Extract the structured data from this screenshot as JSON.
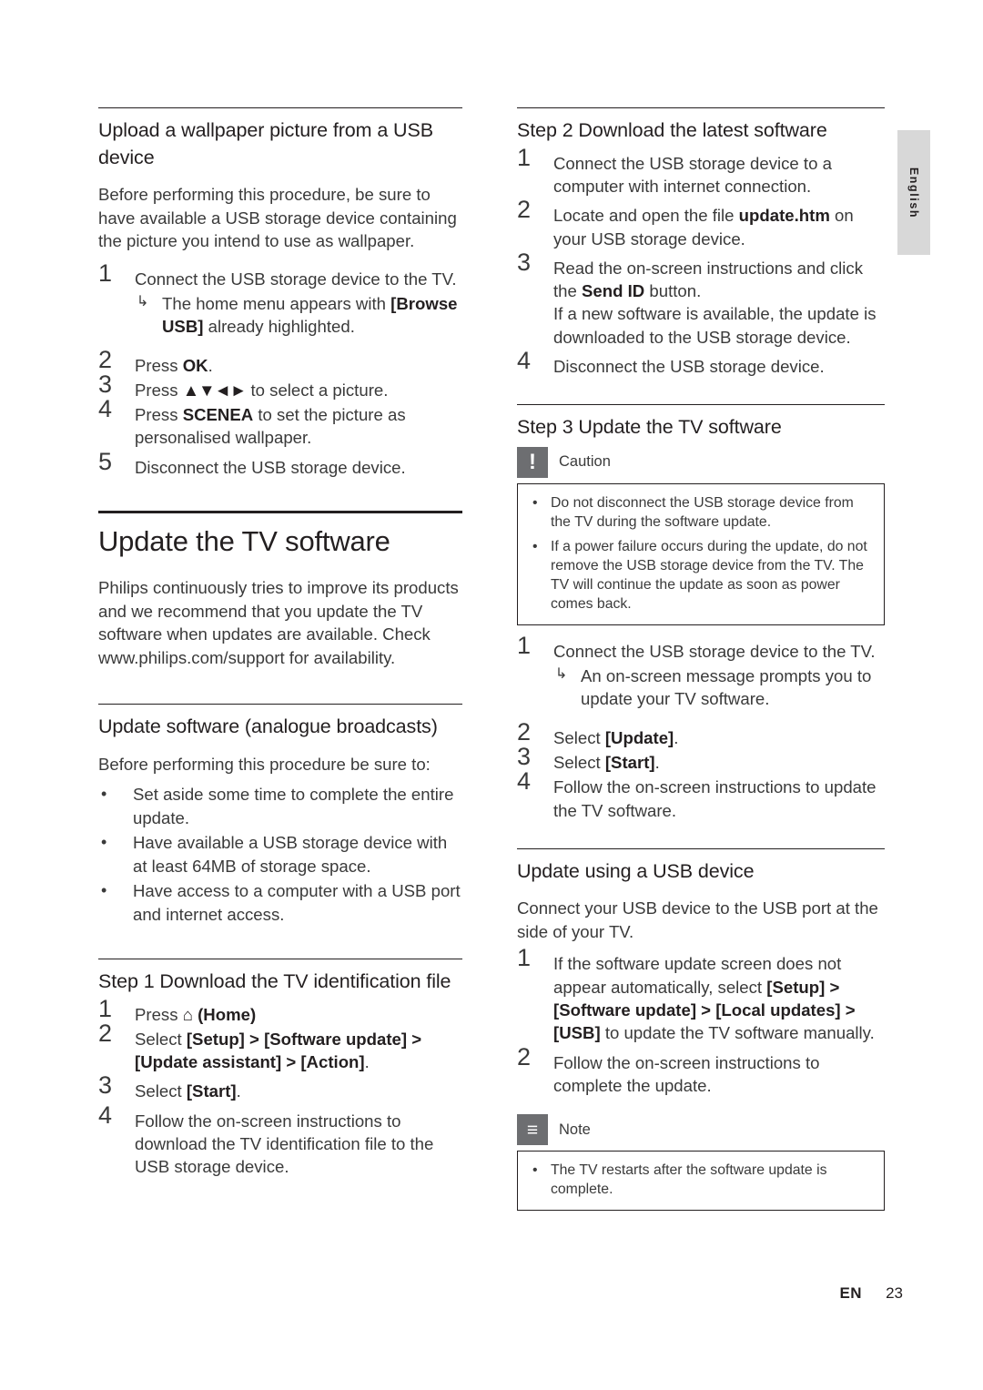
{
  "side_tab": {
    "label": "English"
  },
  "left_column": {
    "section1": {
      "heading": "Upload a wallpaper picture from a USB device",
      "intro": "Before performing this procedure, be sure to have available a USB storage device containing the picture you intend to use as wallpaper.",
      "steps": [
        {
          "num": "1",
          "text": "Connect the USB storage device to the TV.",
          "subnote": "The home menu appears with [Browse USB] already highlighted.",
          "subnote_pre": "The home menu appears with ",
          "subnote_bold": "[Browse USB]",
          "subnote_post": " already highlighted."
        },
        {
          "num": "2",
          "pre": "Press ",
          "bold": "OK",
          "post": "."
        },
        {
          "num": "3",
          "pre": "Press ",
          "bold": "▲▼◄►",
          "post": " to select a picture."
        },
        {
          "num": "4",
          "pre": "Press ",
          "bold": "SCENEA",
          "post": " to set the picture as personalised wallpaper."
        },
        {
          "num": "5",
          "pre": "Disconnect the USB storage device.",
          "bold": "",
          "post": ""
        }
      ]
    },
    "section2": {
      "title": "Update the TV software",
      "intro": "Philips continuously tries to improve its products and we recommend that you update the TV software when updates are available. Check www.philips.com/support for availability."
    },
    "section3": {
      "heading": "Update software (analogue broadcasts)",
      "intro": "Before performing this procedure be sure to:",
      "bullets": [
        "Set aside some time to complete the entire update.",
        "Have available a USB storage device with at least 64MB of storage space.",
        "Have access to a computer with a USB port and internet access."
      ]
    },
    "section4": {
      "heading": "Step 1 Download the TV identification file",
      "steps": [
        {
          "num": "1",
          "pre": "Press ",
          "bold": "⌂ (Home)",
          "post": ""
        },
        {
          "num": "2",
          "pre": "Select ",
          "bold": "[Setup] > [Software update] > [Update assistant] > [Action]",
          "post": "."
        },
        {
          "num": "3",
          "pre": "Select ",
          "bold": "[Start]",
          "post": "."
        },
        {
          "num": "4",
          "pre": "Follow the on-screen instructions to download the TV identification file to the USB storage device.",
          "bold": "",
          "post": ""
        }
      ]
    }
  },
  "right_column": {
    "section1": {
      "heading": "Step 2 Download the latest software",
      "steps": [
        {
          "num": "1",
          "pre": "Connect the USB storage device to a computer with internet connection.",
          "bold": "",
          "post": ""
        },
        {
          "num": "2",
          "pre": "Locate and open the file ",
          "bold": "update.htm",
          "post": " on your USB storage device."
        },
        {
          "num": "3",
          "pre": "Read the on-screen instructions and click the ",
          "bold": "Send ID",
          "post": " button.",
          "extra": "If a new software is available, the update is downloaded to the USB storage device."
        },
        {
          "num": "4",
          "pre": "Disconnect the USB storage device.",
          "bold": "",
          "post": ""
        }
      ]
    },
    "section2": {
      "heading": "Step 3 Update the TV software",
      "caution": {
        "icon": "!",
        "title": "Caution",
        "items": [
          "Do not disconnect the USB storage device from the TV during the software update.",
          "If a power failure occurs during the update, do not remove the USB storage device from the TV. The TV will continue the update as soon as power comes back."
        ]
      },
      "steps": [
        {
          "num": "1",
          "pre": "Connect the USB storage device to the TV.",
          "bold": "",
          "post": "",
          "subnote": "An on-screen message prompts you to update your TV software."
        },
        {
          "num": "2",
          "pre": "Select ",
          "bold": "[Update]",
          "post": "."
        },
        {
          "num": "3",
          "pre": "Select ",
          "bold": "[Start]",
          "post": "."
        },
        {
          "num": "4",
          "pre": "Follow the on-screen instructions to update the TV software.",
          "bold": "",
          "post": ""
        }
      ]
    },
    "section3": {
      "heading": "Update using a USB device",
      "intro": "Connect your USB device to the USB port at the side of your TV.",
      "steps": [
        {
          "num": "1",
          "pre": "If the software update screen does not appear automatically, select ",
          "bold": "[Setup] > [Software update] > [Local updates] > [USB]",
          "post": " to update the TV software manually."
        },
        {
          "num": "2",
          "pre": "Follow the on-screen instructions to complete the update.",
          "bold": "",
          "post": ""
        }
      ],
      "note": {
        "icon": "≡",
        "title": "Note",
        "items": [
          "The TV restarts after the software update is complete."
        ]
      }
    }
  },
  "footer": {
    "lang": "EN",
    "page": "23"
  }
}
